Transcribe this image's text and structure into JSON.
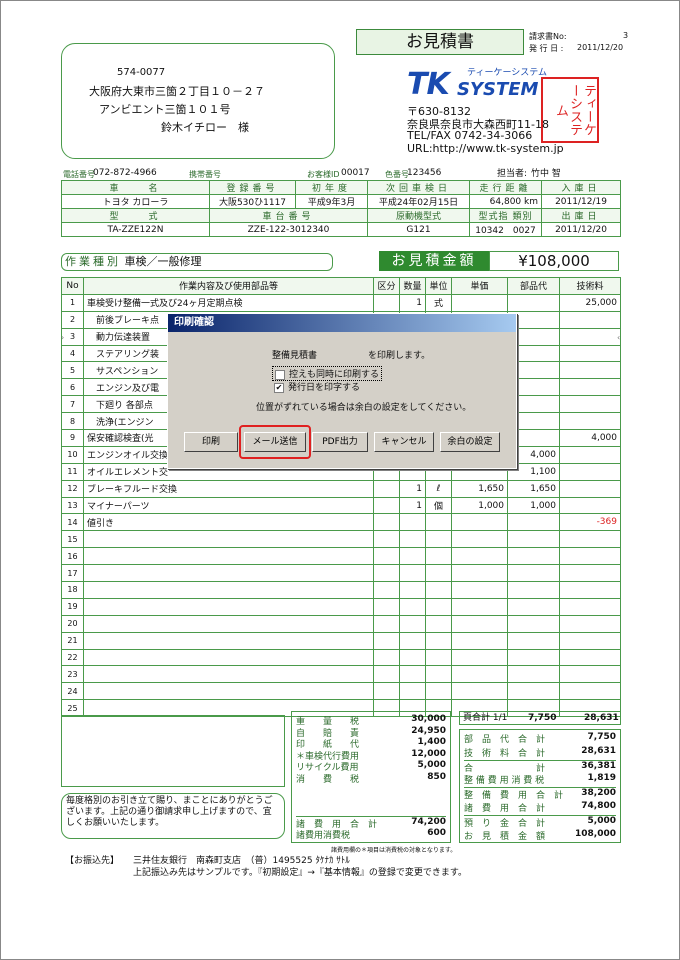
{
  "doc": {
    "title": "お見積書",
    "invoice_no_label": "請求書No:",
    "invoice_no": "3",
    "issue_label": "発 行 日 :",
    "issue_date": "2011/12/20"
  },
  "customer": {
    "zip": "574-0077",
    "address1": "大阪府大東市三箇２丁目１０－２７",
    "address2": "アンビエント三箇１０１号",
    "name": "鈴木イチロー　様"
  },
  "company": {
    "logo_tk": "TK",
    "logo_system": "SYSTEM",
    "kana": "ティーケーシステム",
    "zip": "〒630-8132",
    "address": "奈良県奈良市大森西町11-18",
    "tel": "TEL/FAX 0742-34-3066",
    "url": "URL:http://www.tk-system.jp",
    "stamp": "ティーケーシステム"
  },
  "contact": {
    "tel_label": "電話番号",
    "tel": "072-872-4966",
    "mobile_label": "携帯番号",
    "cust_id_label": "お客様ID",
    "cust_id": "00017",
    "color_label": "色番号",
    "color": "123456",
    "staff_label": "担当者:",
    "staff": "竹中 智"
  },
  "vehicle": {
    "h1": [
      "車　　名",
      "登録番号",
      "初年度",
      "次回車検日",
      "走行距離",
      "入庫日"
    ],
    "v1": [
      "トヨタ カローラ",
      "大阪530ひ1117",
      "平成9年3月",
      "平成24年02月15日",
      "64,800 km",
      "2011/12/19"
    ],
    "h2": [
      "型　　式",
      "車台番号",
      "原動機型式",
      "型式指",
      "類別",
      "出庫日"
    ],
    "v2": [
      "TA-ZZE122N",
      "ZZE-122-3012340",
      "G121",
      "10342",
      "0027",
      "2011/12/20"
    ]
  },
  "work": {
    "label": "作業種別",
    "type": "車検／一般修理",
    "estimate_label": "お見積金額",
    "estimate": "¥108,000"
  },
  "columns": [
    "No",
    "作業内容及び使用部品等",
    "区分",
    "数量",
    "単位",
    "単価",
    "部品代",
    "技術料"
  ],
  "lines": [
    {
      "no": "1",
      "desc": "車検受け整備一式及び24ヶ月定期点検",
      "kubun": "",
      "qty": "1",
      "unit": "式",
      "price": "",
      "parts": "",
      "tech": "25,000"
    },
    {
      "no": "2",
      "desc": "　前後ブレーキ点",
      "kubun": "",
      "qty": "",
      "unit": "",
      "price": "",
      "parts": "",
      "tech": ""
    },
    {
      "no": "3",
      "desc": "　動力伝達装置",
      "kubun": "",
      "qty": "",
      "unit": "",
      "price": "",
      "parts": "",
      "tech": ""
    },
    {
      "no": "4",
      "desc": "　ステアリング装",
      "kubun": "",
      "qty": "",
      "unit": "",
      "price": "",
      "parts": "",
      "tech": ""
    },
    {
      "no": "5",
      "desc": "　サスペンション",
      "kubun": "",
      "qty": "",
      "unit": "",
      "price": "",
      "parts": "",
      "tech": ""
    },
    {
      "no": "6",
      "desc": "　エンジン及び電",
      "kubun": "",
      "qty": "",
      "unit": "",
      "price": "",
      "parts": "",
      "tech": ""
    },
    {
      "no": "7",
      "desc": "　下廻り 各部点",
      "kubun": "",
      "qty": "",
      "unit": "",
      "price": "",
      "parts": "",
      "tech": ""
    },
    {
      "no": "8",
      "desc": "　洗浄(エンジン",
      "kubun": "",
      "qty": "",
      "unit": "",
      "price": "",
      "parts": "",
      "tech": ""
    },
    {
      "no": "9",
      "desc": "保安確認検査(光",
      "kubun": "",
      "qty": "",
      "unit": "",
      "price": "",
      "parts": "",
      "tech": "4,000"
    },
    {
      "no": "10",
      "desc": "エンジンオイル交換",
      "kubun": "",
      "qty": "",
      "unit": "",
      "price": "",
      "parts": "4,000",
      "tech": ""
    },
    {
      "no": "11",
      "desc": "オイルエレメント交",
      "kubun": "",
      "qty": "",
      "unit": "",
      "price": "",
      "parts": "1,100",
      "tech": ""
    },
    {
      "no": "12",
      "desc": "ブレーキフルード交換",
      "kubun": "",
      "qty": "1",
      "unit": "ℓ",
      "price": "1,650",
      "parts": "1,650",
      "tech": ""
    },
    {
      "no": "13",
      "desc": "マイナーパーツ",
      "kubun": "",
      "qty": "1",
      "unit": "個",
      "price": "1,000",
      "parts": "1,000",
      "tech": ""
    },
    {
      "no": "14",
      "desc": "値引き",
      "kubun": "",
      "qty": "",
      "unit": "",
      "price": "",
      "parts": "",
      "tech": "-369"
    },
    {
      "no": "15",
      "desc": "",
      "kubun": "",
      "qty": "",
      "unit": "",
      "price": "",
      "parts": "",
      "tech": ""
    },
    {
      "no": "16",
      "desc": "",
      "kubun": "",
      "qty": "",
      "unit": "",
      "price": "",
      "parts": "",
      "tech": ""
    },
    {
      "no": "17",
      "desc": "",
      "kubun": "",
      "qty": "",
      "unit": "",
      "price": "",
      "parts": "",
      "tech": ""
    },
    {
      "no": "18",
      "desc": "",
      "kubun": "",
      "qty": "",
      "unit": "",
      "price": "",
      "parts": "",
      "tech": ""
    },
    {
      "no": "19",
      "desc": "",
      "kubun": "",
      "qty": "",
      "unit": "",
      "price": "",
      "parts": "",
      "tech": ""
    },
    {
      "no": "20",
      "desc": "",
      "kubun": "",
      "qty": "",
      "unit": "",
      "price": "",
      "parts": "",
      "tech": ""
    },
    {
      "no": "21",
      "desc": "",
      "kubun": "",
      "qty": "",
      "unit": "",
      "price": "",
      "parts": "",
      "tech": ""
    },
    {
      "no": "22",
      "desc": "",
      "kubun": "",
      "qty": "",
      "unit": "",
      "price": "",
      "parts": "",
      "tech": ""
    },
    {
      "no": "23",
      "desc": "",
      "kubun": "",
      "qty": "",
      "unit": "",
      "price": "",
      "parts": "",
      "tech": ""
    },
    {
      "no": "24",
      "desc": "",
      "kubun": "",
      "qty": "",
      "unit": "",
      "price": "",
      "parts": "",
      "tech": ""
    },
    {
      "no": "25",
      "desc": "",
      "kubun": "",
      "qty": "",
      "unit": "",
      "price": "",
      "parts": "",
      "tech": ""
    }
  ],
  "greeting": "毎度格別のお引き立て賜り、まことにありがとうございます。上記の通り御請求申し上げますので、宜しくお願いいたします。",
  "fees": [
    [
      "重　　量　　税",
      "30,000"
    ],
    [
      "自　　賠　　責",
      "24,950"
    ],
    [
      "印　　紙　　代",
      "1,400"
    ],
    [
      "＊車検代行費用",
      "12,000"
    ],
    [
      "リサイクル費用",
      "5,000"
    ],
    [
      "消　　費　　税",
      "850"
    ]
  ],
  "fees_total": [
    [
      "諸　費　用　合　計",
      "74,200"
    ],
    [
      "諸費用消費税",
      "600"
    ]
  ],
  "fees_note": "諸費用欄の＊項目は消費税の対象となります。",
  "subtotal": {
    "label": "頁合計 1/1",
    "parts": "7,750",
    "tech": "28,631"
  },
  "totals": [
    [
      "部　品　代　合　計",
      "7,750"
    ],
    [
      "技　術　料　合　計",
      "28,631"
    ],
    [
      "合　　　　　　　計",
      "36,381"
    ],
    [
      "整 備 費 用 消 費 税",
      "1,819"
    ],
    [
      "整　備　費　用　合　計",
      "38,200"
    ],
    [
      "諸　費　用　合　計",
      "74,800"
    ],
    [
      "預　り　金　合　計",
      "5,000"
    ],
    [
      "お　見　積　金　額",
      "108,000"
    ]
  ],
  "bank": {
    "label": "【お振込先】",
    "info": "三井住友銀行　南森町支店　（普）1495525 ﾀｹﾅｶ ｻﾄﾙ",
    "note": "上記振込み先はサンプルです。『初期設定』→『基本情報』の登録で変更できます。"
  },
  "dialog": {
    "title": "印刷確認",
    "message_doc": "整備見積書",
    "message_tail": "を印刷します。",
    "opt_copy": "控えも同時に印刷する",
    "opt_issue": "発行日を印字する",
    "opt_issue_check": "✔",
    "note": "位置がずれている場合は余白の設定をしてください。",
    "buttons": {
      "print": "印刷",
      "mail": "メール送信",
      "pdf": "PDF出力",
      "cancel": "キャンセル",
      "margin": "余白の設定"
    }
  }
}
